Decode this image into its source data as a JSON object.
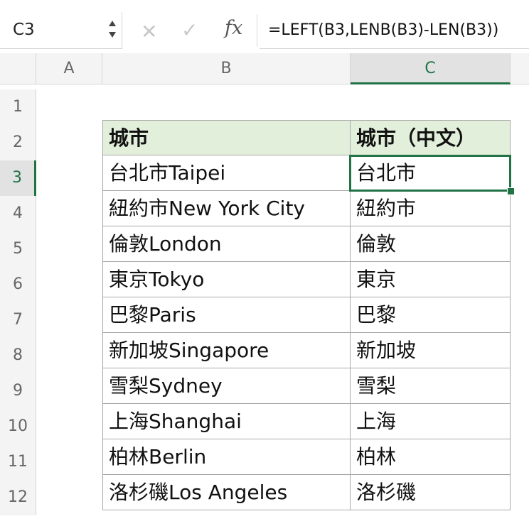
{
  "formula_bar": {
    "name_box": "C3",
    "cancel_symbol": "✕",
    "enter_symbol": "✓",
    "fx_label": "fx",
    "formula": "=LEFT(B3,LENB(B3)-LEN(B3))"
  },
  "columns": [
    "A",
    "B",
    "C"
  ],
  "rows": [
    "1",
    "2",
    "3",
    "4",
    "5",
    "6",
    "7",
    "8",
    "9",
    "10",
    "11",
    "12"
  ],
  "active": {
    "row": "3",
    "column": "C"
  },
  "colors": {
    "accent": "#217346",
    "header_fill": "#e2efda"
  },
  "table": {
    "headers": [
      "城市",
      "城市（中文）"
    ],
    "rows": [
      [
        "台北市Taipei",
        "台北市"
      ],
      [
        "紐約市New York City",
        "紐約市"
      ],
      [
        "倫敦London",
        "倫敦"
      ],
      [
        "東京Tokyo",
        "東京"
      ],
      [
        "巴黎Paris",
        "巴黎"
      ],
      [
        "新加坡Singapore",
        "新加坡"
      ],
      [
        "雪梨Sydney",
        "雪梨"
      ],
      [
        "上海Shanghai",
        "上海"
      ],
      [
        "柏林Berlin",
        "柏林"
      ],
      [
        "洛杉磯Los Angeles",
        "洛杉磯"
      ]
    ]
  }
}
